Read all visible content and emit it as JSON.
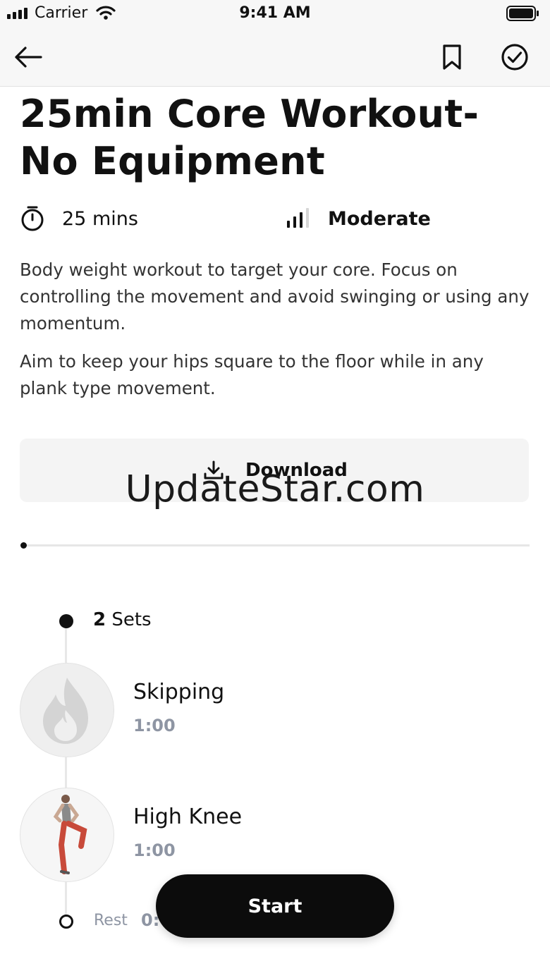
{
  "status_bar": {
    "carrier": "Carrier",
    "time": "9:41 AM"
  },
  "nav": {
    "back_icon": "arrow-left-icon",
    "bookmark_icon": "bookmark-icon",
    "complete_icon": "check-circle-icon"
  },
  "workout": {
    "title": "25min Core Workout- No Equipment",
    "duration": "25 mins",
    "duration_icon": "stopwatch-icon",
    "difficulty": "Moderate",
    "difficulty_icon": "signal-bars-icon",
    "description_1": "Body weight workout to target your core. Focus on controlling the movement and avoid swinging or using any momentum.",
    "description_2": "Aim to keep your hips square to the floor while in any plank type movement."
  },
  "download": {
    "label": "Download",
    "icon": "download-icon"
  },
  "watermark": "UpdateStar.com",
  "timeline": {
    "sets_count": "2",
    "sets_label": " Sets",
    "exercises": [
      {
        "name": "Skipping",
        "duration": "1:00",
        "thumb_icon": "flame-placeholder-icon"
      },
      {
        "name": "High Knee",
        "duration": "1:00",
        "thumb_icon": "exercise-figure-icon"
      }
    ],
    "rest_label": "Rest",
    "rest_duration": "0:"
  },
  "start_button": {
    "label": "Start"
  }
}
